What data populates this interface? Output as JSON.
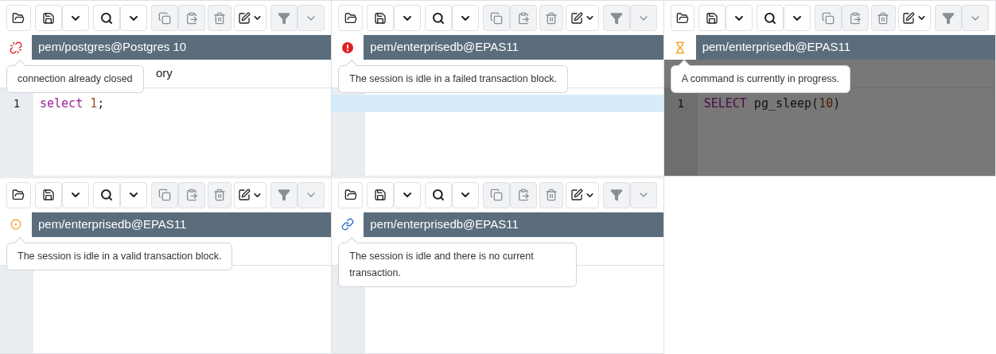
{
  "panels": [
    {
      "status": {
        "kind": "disconnected",
        "tooltip": "connection already closed"
      },
      "connection": "pem/postgres@Postgres 10",
      "busy": false,
      "tab_label": "ory",
      "lines": [
        {
          "number": "1",
          "highlighted": false,
          "tokens": [
            {
              "kind": "keyword",
              "text": "select"
            },
            {
              "kind": "number",
              "text": "1"
            },
            {
              "kind": "plain",
              "text": ";"
            }
          ]
        }
      ]
    },
    {
      "status": {
        "kind": "failed",
        "tooltip": "The session is idle in a failed transaction block."
      },
      "connection": "pem/enterprisedb@EPAS11",
      "busy": false,
      "lines": [
        {
          "highlighted": true
        }
      ]
    },
    {
      "status": {
        "kind": "busy",
        "tooltip": "A command is currently in progress."
      },
      "connection": "pem/enterprisedb@EPAS11",
      "busy": true,
      "lines": [
        {
          "number": "1",
          "highlighted": false,
          "tokens": [
            {
              "kind": "keyword",
              "text": "SELECT"
            },
            {
              "kind": "plain",
              "text": "pg_sleep("
            },
            {
              "kind": "number",
              "text": "10"
            },
            {
              "kind": "plain",
              "text": ")"
            }
          ]
        }
      ]
    },
    {
      "status": {
        "kind": "in_transaction",
        "tooltip": "The session is idle in a valid transaction block."
      },
      "connection": "pem/enterprisedb@EPAS11",
      "busy": false
    },
    {
      "status": {
        "kind": "idle",
        "tooltip": "The session is idle and there is no current transaction."
      },
      "connection": "pem/enterprisedb@EPAS11",
      "busy": false
    }
  ]
}
